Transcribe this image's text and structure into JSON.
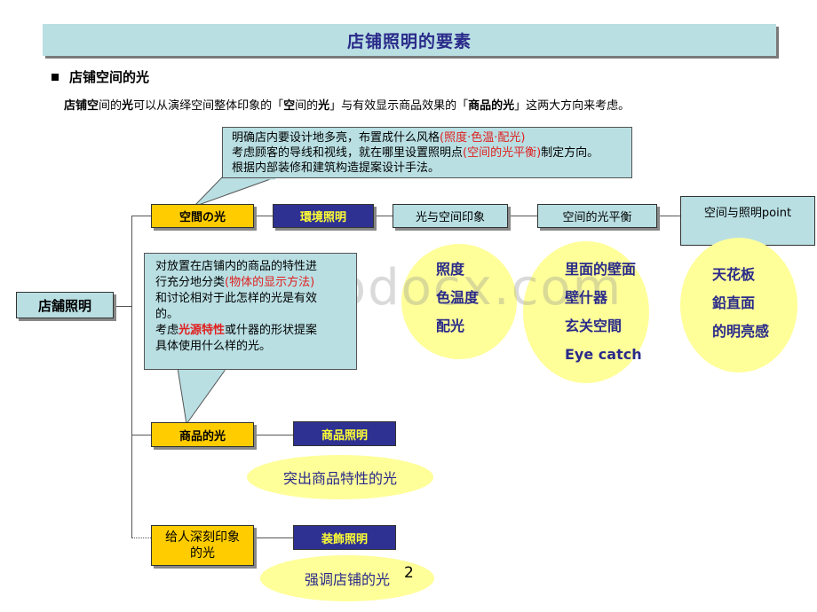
{
  "page": {
    "title": "店铺照明的要素",
    "section_heading": "店铺空间的光",
    "intro": {
      "p1": "店铺",
      "p2": "空",
      "p3": "间的",
      "p4": "光",
      "p5": "可以从演绎空间整体印象的「",
      "p6": "空",
      "p7": "间的",
      "p8": "光",
      "p9": "」与有效显示商品效果的「",
      "p10": "商品的光",
      "p11": "」这两大方向来考虑。"
    },
    "page_number": "2",
    "watermark": "wodocx.com"
  },
  "callout_top": {
    "line1_text": "明确店内要设计地多亮，布置成什么风格",
    "line1_red": "(照度·色温·配光)",
    "line2_text": "考虑顾客的导线和视线，就在哪里设置照明点",
    "line2_red": "(空间的光平衡)",
    "line2_tail": "制定方向。",
    "line3_text": "根据内部装修和建筑构造提案设计手法。"
  },
  "callout_mid": {
    "l1": "对放置在店铺内的商品的特性进",
    "l2a": "行充分地分类",
    "l2red": "(物体的显示方法)",
    "l3": "和讨论相对于此怎样的光是有效",
    "l4": "的。",
    "l5a": "考虑",
    "l5red": "光源特性",
    "l5b": "或什器的形状提案",
    "l6": "具体使用什么样的光。"
  },
  "diagram": {
    "root": "店舗照明",
    "branch1": {
      "label": "空間の光",
      "lighting": "環境照明",
      "step1": "光与空间印象",
      "step2": "空间的光平衡",
      "step3": "空间与照明point"
    },
    "branch2": {
      "label": "商品的光",
      "lighting": "商品照明",
      "note": "突出商品特性的光"
    },
    "branch3": {
      "label_line1": "给人深刻印象",
      "label_line2": "的光",
      "lighting": "装飾照明",
      "note": "强调店铺的光"
    },
    "circles": [
      {
        "items": [
          "照度",
          "色温度",
          "配光"
        ]
      },
      {
        "items": [
          "里面的壁面",
          "壁什器",
          "玄关空間",
          "Eye catch"
        ]
      },
      {
        "items": [
          "天花板",
          "鉛直面",
          "的明亮感"
        ]
      }
    ]
  },
  "colors": {
    "teal_fill": "#b9dfe3",
    "gold_fill": "#ffcc00",
    "navy_fill": "#2e3192",
    "navy_text_yellow": "#ffff33",
    "circle_fill": "#ffff99",
    "heading_blue": "#2a2a8a",
    "accent_red": "#e02020"
  }
}
